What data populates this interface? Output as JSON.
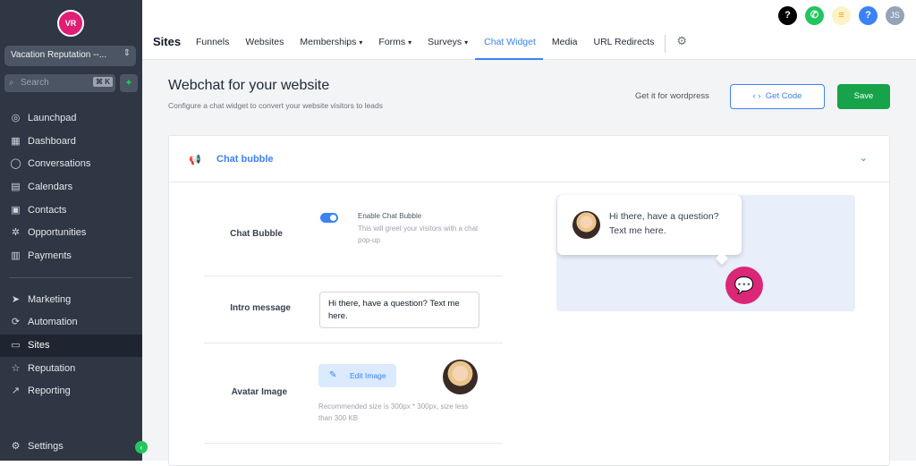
{
  "brand": {
    "logo_text": "VR"
  },
  "account": {
    "name": "Vacation Reputation --..."
  },
  "search": {
    "placeholder": "Search",
    "shortcut": "⌘ K"
  },
  "sidebar": {
    "items": [
      {
        "label": "Launchpad",
        "icon": "rocket-icon"
      },
      {
        "label": "Dashboard",
        "icon": "dashboard-icon"
      },
      {
        "label": "Conversations",
        "icon": "chat-icon"
      },
      {
        "label": "Calendars",
        "icon": "calendar-icon"
      },
      {
        "label": "Contacts",
        "icon": "contacts-icon"
      },
      {
        "label": "Opportunities",
        "icon": "opportunities-icon"
      },
      {
        "label": "Payments",
        "icon": "payments-icon"
      },
      {
        "label": "Marketing",
        "icon": "send-icon"
      },
      {
        "label": "Automation",
        "icon": "automation-icon"
      },
      {
        "label": "Sites",
        "icon": "sites-icon",
        "active": true
      },
      {
        "label": "Reputation",
        "icon": "star-icon"
      },
      {
        "label": "Reporting",
        "icon": "chart-icon"
      }
    ],
    "settings": {
      "label": "Settings",
      "icon": "gear-icon"
    }
  },
  "topbar": {
    "section_title": "Sites",
    "tabs": [
      {
        "label": "Funnels"
      },
      {
        "label": "Websites"
      },
      {
        "label": "Memberships",
        "dropdown": true
      },
      {
        "label": "Forms",
        "dropdown": true
      },
      {
        "label": "Surveys",
        "dropdown": true
      },
      {
        "label": "Chat Widget",
        "active": true
      },
      {
        "label": "Media"
      },
      {
        "label": "URL Redirects"
      }
    ],
    "user_initials": "JS"
  },
  "page": {
    "title": "Webchat for your website",
    "subtitle": "Configure a chat widget to convert your website visitors to leads",
    "wordpress_link": "Get it for wordpress",
    "get_code_label": "Get Code",
    "save_label": "Save"
  },
  "chat_bubble": {
    "section_title": "Chat bubble",
    "row_chat_bubble": "Chat Bubble",
    "toggle_title": "Enable Chat Bubble",
    "toggle_desc": "This will greet your visitors with a chat pop-up",
    "toggle_on": true,
    "row_intro": "Intro message",
    "intro_value": "Hi there, have a question? Text me here.",
    "row_avatar": "Avatar Image",
    "edit_image_label": "Edit Image",
    "recommendation": "Recommended size is 300px * 300px, size less than 300 KB"
  },
  "preview": {
    "message": "Hi there, have a question? Text me here."
  },
  "colors": {
    "accent": "#3b82f6",
    "save": "#16a34a",
    "chat_icon": "#db2777",
    "sidebar": "#2f3744"
  }
}
